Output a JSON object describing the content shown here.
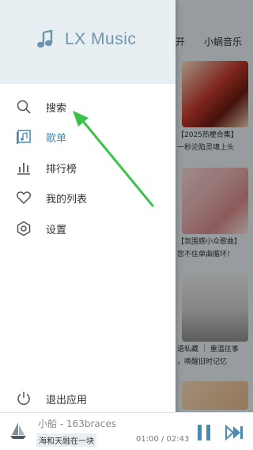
{
  "app": {
    "name": "LX Music"
  },
  "background": {
    "tabs": [
      "开",
      "小蜗音乐"
    ],
    "cards": [
      {
        "title_line1": "【2025热梗合集】",
        "title_line2": "一秒沦陷灵魂上头"
      },
      {
        "title_line1": "【氛围感小众歌曲】",
        "title_line2": "您不住单曲循环！"
      },
      {
        "title_line1": "语私藏 ｜ 重温往事",
        "title_line2": "，唤醒旧时记忆"
      },
      {
        "title_line1": "",
        "title_line2": ""
      }
    ]
  },
  "menu": {
    "items": [
      {
        "label": "搜索",
        "icon": "search-icon"
      },
      {
        "label": "歌单",
        "icon": "playlist-icon"
      },
      {
        "label": "排行榜",
        "icon": "leaderboard-icon"
      },
      {
        "label": "我的列表",
        "icon": "heart-icon"
      },
      {
        "label": "设置",
        "icon": "settings-icon"
      }
    ],
    "exit": {
      "label": "退出应用",
      "icon": "power-icon"
    }
  },
  "player": {
    "song": "小船 - 163braces",
    "lyric": "海和天融在一块",
    "time": "01:00 / 02:43"
  },
  "colors": {
    "accent": "#4a8ab0",
    "header_bg": "#e7eff3",
    "arrow": "#3cc24a"
  }
}
